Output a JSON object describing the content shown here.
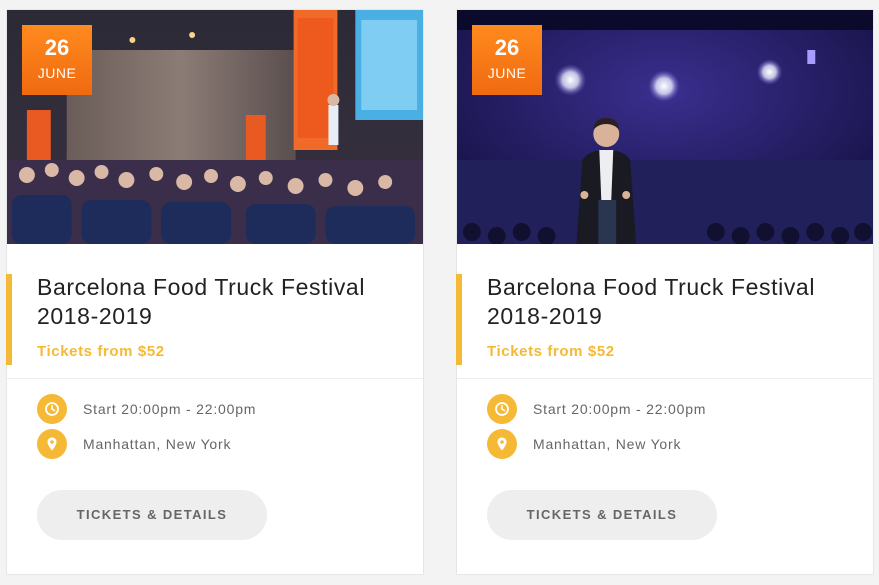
{
  "colors": {
    "accent": "#f6b935",
    "badge": "#f47a16",
    "button_bg": "#eeeeee",
    "title": "#222222",
    "meta_text": "#666666"
  },
  "events": [
    {
      "date_day": "26",
      "date_month": "JUNE",
      "title": "Barcelona Food Truck Festival 2018-2019",
      "price": "Tickets from $52",
      "time": "Start 20:00pm - 22:00pm",
      "location": "Manhattan, New York",
      "button_label": "TICKETS & DETAILS",
      "image": "conference-audience-photo"
    },
    {
      "date_day": "26",
      "date_month": "JUNE",
      "title": "Barcelona Food Truck Festival 2018-2019",
      "price": "Tickets from $52",
      "time": "Start 20:00pm - 22:00pm",
      "location": "Manhattan, New York",
      "button_label": "TICKETS & DETAILS",
      "image": "speaker-on-stage-photo"
    }
  ],
  "icons": {
    "time": "clock-icon",
    "location": "map-pin-icon"
  }
}
